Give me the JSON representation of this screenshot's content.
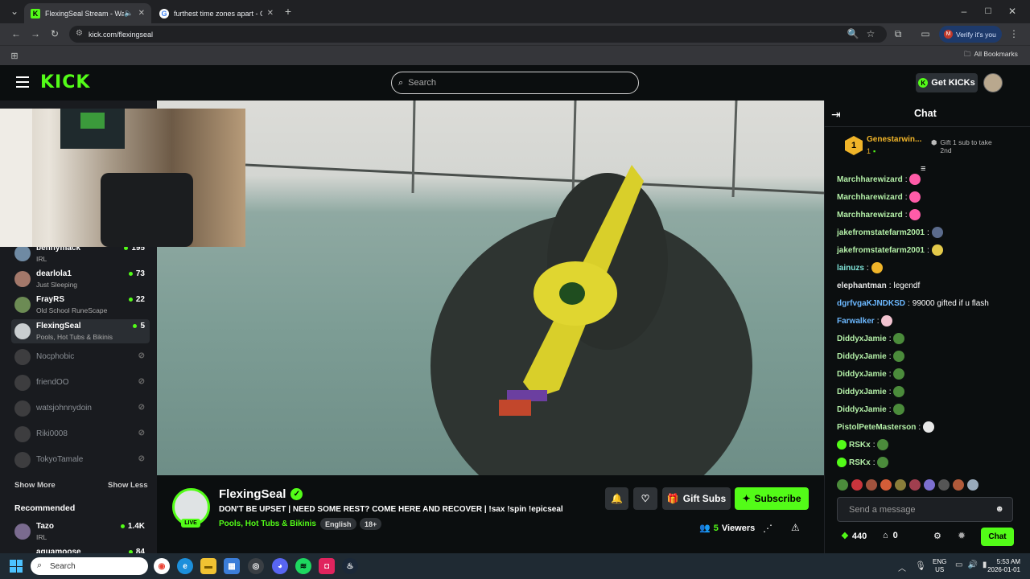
{
  "browser": {
    "tabs": [
      {
        "title": "FlexingSeal Stream - Watch",
        "active": true
      },
      {
        "title": "furthest time zones apart - Goo",
        "active": false
      }
    ],
    "url": "kick.com/flexingseal",
    "profile_label": "Verify it's you",
    "profile_initial": "M",
    "bookmarks_label": "All Bookmarks"
  },
  "header": {
    "logo": "KICK",
    "search_placeholder": "Search",
    "get_kicks": "Get KICKs"
  },
  "sidebar": {
    "channels": [
      {
        "name": "bennymack",
        "category": "IRL",
        "viewers": "195",
        "live": true
      },
      {
        "name": "dearlola1",
        "category": "Just Sleeping",
        "viewers": "73",
        "live": true
      },
      {
        "name": "FrayRS",
        "category": "Old School RuneScape",
        "viewers": "22",
        "live": true
      },
      {
        "name": "FlexingSeal",
        "category": "Pools, Hot Tubs & Bikinis",
        "viewers": "5",
        "live": true
      },
      {
        "name": "Nocphobic",
        "live": false
      },
      {
        "name": "friendOO",
        "live": false
      },
      {
        "name": "watsjohnnydoin",
        "live": false
      },
      {
        "name": "Riki0008",
        "live": false
      },
      {
        "name": "TokyoTamale",
        "live": false
      }
    ],
    "show_more": "Show More",
    "show_less": "Show Less",
    "recommended_title": "Recommended",
    "recommended": [
      {
        "name": "Tazo",
        "category": "IRL",
        "viewers": "1.4K"
      },
      {
        "name": "aquamoose",
        "viewers": "84"
      }
    ]
  },
  "stream": {
    "streamer": "FlexingSeal",
    "title": "DON'T BE UPSET | NEED SOME REST? COME HERE AND RECOVER | !sax !spin !epicseal",
    "category": "Pools, Hot Tubs & Bikinis",
    "language": "English",
    "rating": "18+",
    "live_label": "LIVE",
    "viewers_count": "5",
    "viewers_label": "Viewers",
    "gift_subs": "Gift Subs",
    "subscribe": "Subscribe"
  },
  "chat": {
    "title": "Chat",
    "pinned_user": "Genestarwin...",
    "pinned_rank": "1",
    "pinned_count": "1",
    "gift_prompt": "Gift 1 sub to take 2nd",
    "messages": [
      {
        "user": "Marchharewizard",
        "text": "",
        "color": "#b4f0a8"
      },
      {
        "user": "Marchharewizard",
        "text": "",
        "color": "#b4f0a8"
      },
      {
        "user": "Marchharewizard",
        "text": "",
        "color": "#b4f0a8"
      },
      {
        "user": "jakefromstatefarm2001",
        "text": "",
        "color": "#b4f0a8"
      },
      {
        "user": "jakefromstatefarm2001",
        "text": "",
        "color": "#b4f0a8"
      },
      {
        "user": "lainuzs",
        "text": "",
        "color": "#7fe3d7"
      },
      {
        "user": "elephantman",
        "text": "legendf",
        "color": "#e6e6e6"
      },
      {
        "user": "dgrfvgaKJNDKSD",
        "text": "99000 gifted if u flash",
        "color": "#6cb8ff"
      },
      {
        "user": "Farwalker",
        "text": "",
        "color": "#6cb8ff"
      },
      {
        "user": "DiddyxJamie",
        "text": "",
        "color": "#b4f0a8"
      },
      {
        "user": "DiddyxJamie",
        "text": "",
        "color": "#b4f0a8"
      },
      {
        "user": "DiddyxJamie",
        "text": "",
        "color": "#b4f0a8"
      },
      {
        "user": "DiddyxJamie",
        "text": "",
        "color": "#b4f0a8"
      },
      {
        "user": "DiddyxJamie",
        "text": "",
        "color": "#b4f0a8"
      },
      {
        "user": "PistolPeteMasterson",
        "text": "",
        "color": "#b4f0a8"
      },
      {
        "user": "RSKx",
        "text": "",
        "color": "#b4f0a8"
      },
      {
        "user": "RSKx",
        "text": "",
        "color": "#b4f0a8"
      }
    ],
    "input_placeholder": "Send a message",
    "points": "440",
    "other_count": "0",
    "send_label": "Chat"
  },
  "taskbar": {
    "search_placeholder": "Search",
    "lang_top": "ENG",
    "lang_bottom": "US",
    "time": "5:53 AM",
    "date": "2026-01-01"
  },
  "colors": {
    "accent": "#53fc18",
    "background": "#0b0e0f",
    "sidebar": "#191b1f"
  }
}
